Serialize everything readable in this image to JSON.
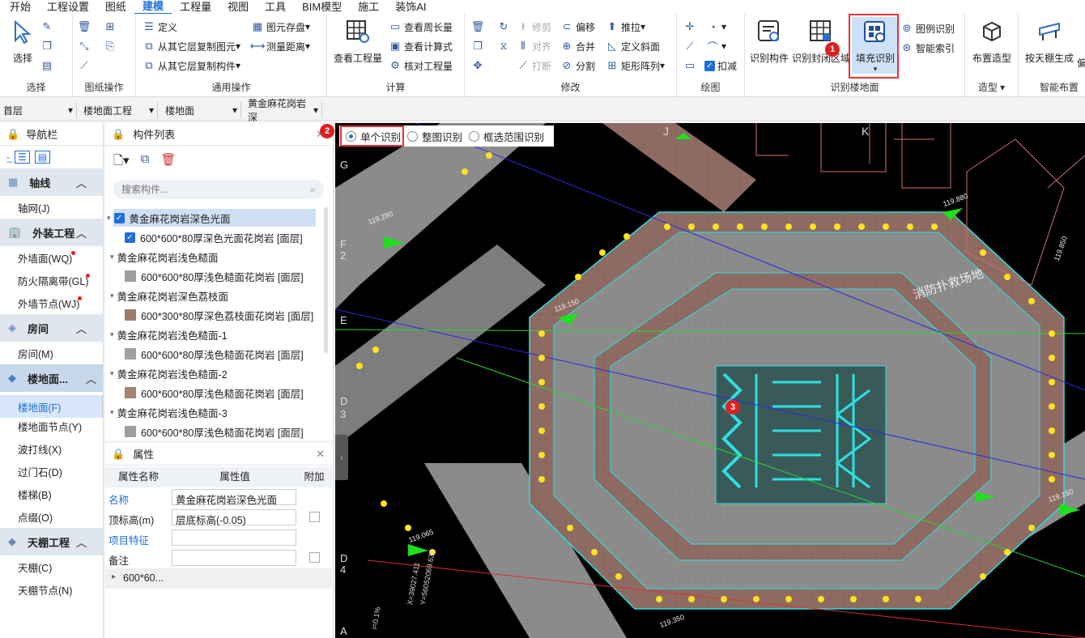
{
  "menu": [
    "开始",
    "工程设置",
    "图纸",
    "建模",
    "工程量",
    "视图",
    "工具",
    "BIM模型",
    "施工",
    "装饰AI"
  ],
  "ribbon": {
    "select": {
      "label": "选择",
      "group": "选择"
    },
    "drawing_ops": {
      "group": "图纸操作"
    },
    "general": {
      "define": "定义",
      "copy_from_floor": "从其它层复制图元",
      "copy_component": "从其它层复制构件",
      "store": "图元存盘",
      "measure": "测量距离",
      "group": "通用操作"
    },
    "calc": {
      "view_qty": "查看工程量",
      "view_perimeter": "查看周长量",
      "view_formula": "查看计算式",
      "check_qty": "核对工程量",
      "group": "计算"
    },
    "modify": {
      "trim": "修剪",
      "align": "对齐",
      "break": "打断",
      "offset": "偏移",
      "merge": "合并",
      "split": "分割",
      "push": "推拉",
      "slope": "定义斜面",
      "array": "矩形阵列",
      "group": "修改"
    },
    "draw": {
      "deduct": "扣减",
      "group": "绘图"
    },
    "recognize": {
      "identify_comp": "识别构件",
      "identify_closed": "识别封闭区域",
      "fill_identify": "填充识别",
      "legend_identify": "图例识别",
      "smart_index": "智能索引",
      "group": "识别楼地面"
    },
    "model": {
      "place": "布置造型",
      "group": "造型"
    },
    "smart": {
      "ceiling_gen": "按天棚生成",
      "group": "智能布置",
      "extra": "偏"
    }
  },
  "badges": {
    "b1": "1",
    "b2": "2",
    "b3": "3"
  },
  "selectors": [
    "首层",
    "楼地面工程",
    "楼地面",
    "黄金麻花岗岩深"
  ],
  "nav": {
    "title": "导航栏",
    "categories": [
      {
        "name": "轴线",
        "items": [
          "轴网(J)"
        ]
      },
      {
        "name": "外装工程",
        "items": [
          "外墙面(WQ)",
          "防火隔离带(GL)",
          "外墙节点(WJ)"
        ]
      },
      {
        "name": "房间",
        "items": [
          "房间(M)"
        ]
      },
      {
        "name": "楼地面...",
        "items": [
          "楼地面(F)",
          "楼地面节点(Y)",
          "波打线(X)",
          "过门石(D)",
          "楼梯(B)",
          "点缀(O)"
        ]
      },
      {
        "name": "天棚工程",
        "items": [
          "天棚(C)",
          "天棚节点(N)"
        ]
      }
    ]
  },
  "components": {
    "title": "构件列表",
    "search_placeholder": "搜索构件...",
    "tree": [
      {
        "group": "黄金麻花岗岩深色光面",
        "child": "600*600*80厚深色光面花岗岩 [面层]",
        "color": "#888888"
      },
      {
        "group": "黄金麻花岗岩浅色糙面",
        "child": "600*600*80厚浅色糙面花岗岩 [面层]",
        "color": "#9e9e9e"
      },
      {
        "group": "黄金麻花岗岩深色荔枝面",
        "child": "600*300*80厚深色荔枝面花岗岩 [面层]",
        "color": "#9c7a6a"
      },
      {
        "group": "黄金麻花岗岩浅色糙面-1",
        "child": "600*600*80厚浅色糙面花岗岩 [面层]",
        "color": "#a0a0a0"
      },
      {
        "group": "黄金麻花岗岩浅色糙面-2",
        "child": "600*600*80厚浅色糙面花岗岩 [面层]",
        "color": "#a58373"
      },
      {
        "group": "黄金麻花岗岩浅色糙面-3",
        "child": "600*600*80厚浅色糙面花岗岩 [面层]",
        "color": "#9e9e9e"
      }
    ]
  },
  "props": {
    "title": "属性",
    "cols": [
      "属性名称",
      "属性值",
      "附加"
    ],
    "rows": [
      {
        "name": "名称",
        "value": "黄金麻花岗岩深色光面"
      },
      {
        "name": "顶标高(m)",
        "value": "层底标高(-0.05)"
      },
      {
        "name": "项目特征",
        "value": ""
      },
      {
        "name": "备注",
        "value": ""
      }
    ],
    "sub": "600*60..."
  },
  "options": {
    "single": "单个识别",
    "whole": "整图识别",
    "box": "框选范围识别"
  },
  "canvas_labels": {
    "fire": "消防扑救场地",
    "axis": [
      "G",
      "F",
      "2",
      "E",
      "D",
      "3",
      "D",
      "4",
      "J",
      "K",
      "A"
    ],
    "elev": [
      "119.280",
      "119.150",
      "119.080",
      "119.065",
      "119.150",
      "119.065",
      "119.880",
      "119.850",
      "119.850",
      "119.350"
    ],
    "coords": [
      "X=39027.411",
      "Y=56052069.634",
      "i=0.1%"
    ]
  }
}
